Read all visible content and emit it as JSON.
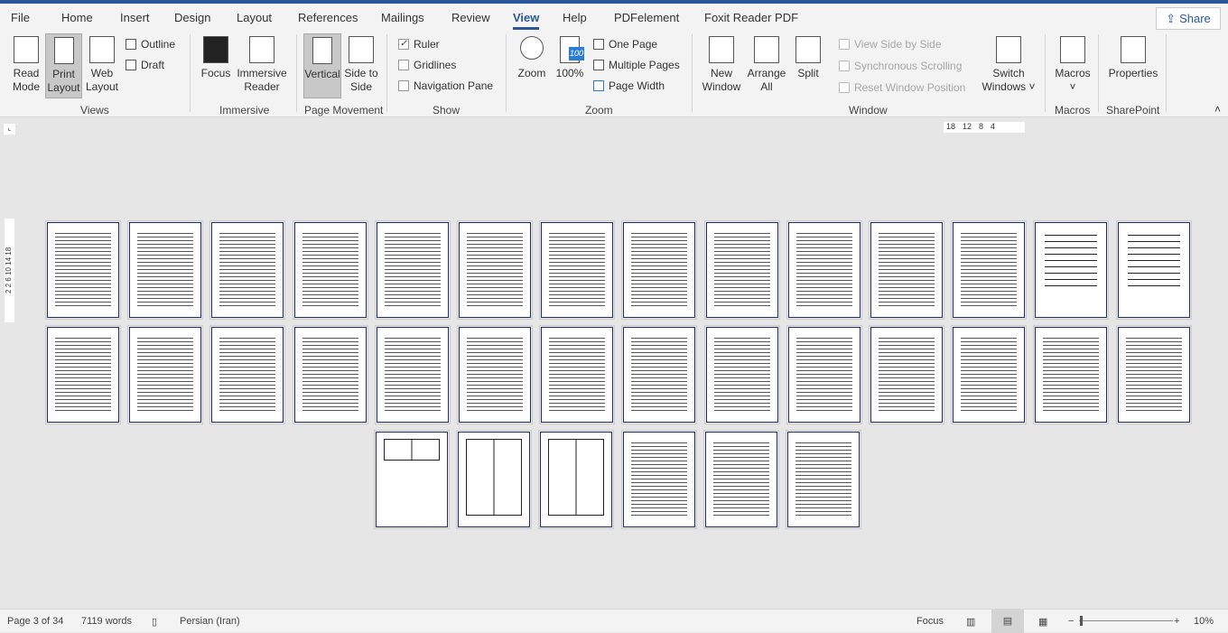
{
  "tabs": [
    "File",
    "Home",
    "Insert",
    "Design",
    "Layout",
    "References",
    "Mailings",
    "Review",
    "View",
    "Help",
    "PDFelement",
    "Foxit Reader PDF"
  ],
  "active_tab": "View",
  "share": "Share",
  "views": {
    "read_mode": "Read Mode",
    "print_layout": "Print Layout",
    "web_layout": "Web Layout",
    "outline": "Outline",
    "draft": "Draft",
    "label": "Views"
  },
  "immersive": {
    "focus": "Focus",
    "reader": "Immersive Reader",
    "label": "Immersive"
  },
  "page_movement": {
    "vertical": "Vertical",
    "side": "Side to Side",
    "label": "Page Movement"
  },
  "show": {
    "ruler": "Ruler",
    "ruler_checked": true,
    "gridlines": "Gridlines",
    "gridlines_checked": false,
    "nav": "Navigation Pane",
    "nav_checked": false,
    "label": "Show"
  },
  "zoom": {
    "zoom": "Zoom",
    "pct": "100%",
    "one": "One Page",
    "multi": "Multiple Pages",
    "width": "Page Width",
    "label": "Zoom",
    "badge": "100"
  },
  "window": {
    "new": "New Window",
    "arrange": "Arrange All",
    "split": "Split",
    "side": "View Side by Side",
    "sync": "Synchronous Scrolling",
    "reset": "Reset Window Position",
    "switch": "Switch Windows",
    "label": "Window"
  },
  "macros": {
    "btn": "Macros",
    "label": "Macros"
  },
  "sharepoint": {
    "props": "Properties",
    "label": "SharePoint"
  },
  "ruler_ticks": [
    "18",
    "12",
    "8",
    "4"
  ],
  "vruler_ticks": "2 2 6 10 14 18",
  "pages": [
    "text",
    "text",
    "text",
    "text",
    "text",
    "text",
    "text",
    "text",
    "text",
    "text",
    "text",
    "text",
    "lines",
    "lines",
    "text",
    "text",
    "text",
    "text",
    "text",
    "text",
    "text",
    "text",
    "text",
    "text",
    "text",
    "text",
    "text",
    "text",
    "tablesmall",
    "table",
    "table",
    "text",
    "text",
    "text"
  ],
  "status": {
    "page": "Page 3 of 34",
    "words": "7119 words",
    "language": "Persian (Iran)",
    "focus": "Focus",
    "zoom": "10%",
    "zoom_level_percent": 10
  },
  "colors": {
    "accent": "#2b579a"
  }
}
